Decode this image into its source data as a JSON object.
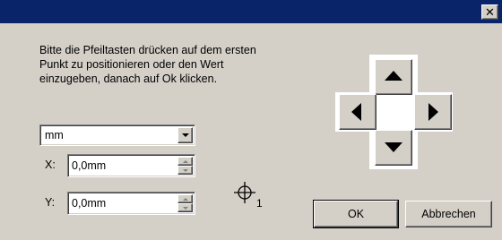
{
  "window": {
    "title": "",
    "close_label": "✕"
  },
  "instruction": "Bitte die Pfeiltasten drücken auf dem ersten Punkt zu positionieren oder den Wert einzugeben, danach auf Ok klicken.",
  "unit_select": {
    "selected": "mm"
  },
  "fields": {
    "x": {
      "label": "X:",
      "value": "0,0mm"
    },
    "y": {
      "label": "Y:",
      "value": "0,0mm"
    }
  },
  "point_marker": {
    "index": "1"
  },
  "buttons": {
    "ok": "OK",
    "cancel": "Abbrechen"
  },
  "colors": {
    "titlebar": "#0a246a",
    "face": "#d4d0c8"
  }
}
